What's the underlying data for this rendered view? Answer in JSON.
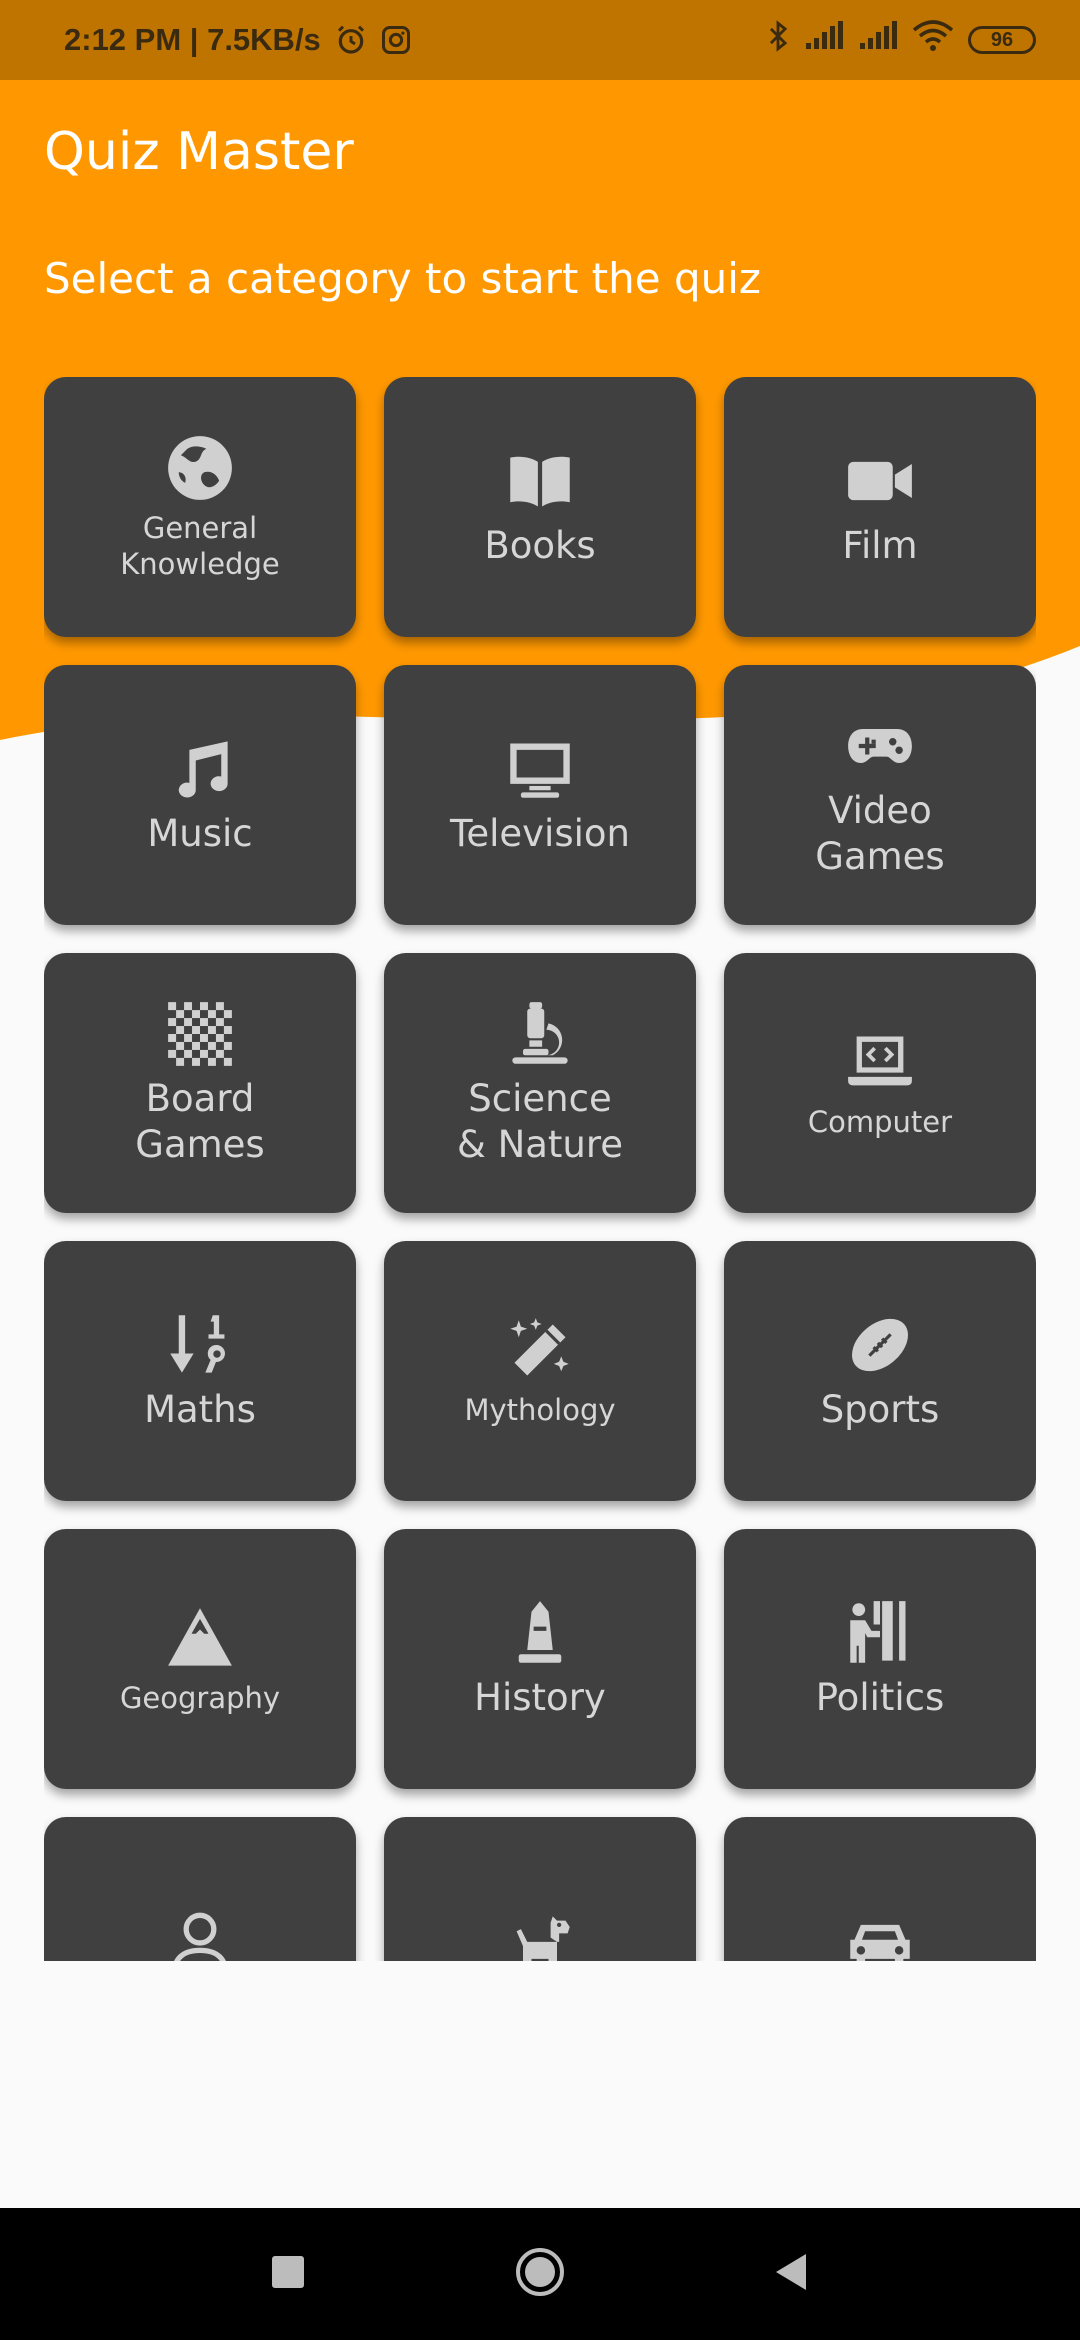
{
  "status_bar": {
    "time": "2:12 PM",
    "speed": "7.5KB/s",
    "battery": "96",
    "icons": [
      "alarm-icon",
      "instagram-icon",
      "bluetooth-icon",
      "signal-icon",
      "signal-icon",
      "wifi-icon",
      "battery-icon"
    ]
  },
  "app": {
    "title": "Quiz Master",
    "subtitle": "Select a category to start the quiz"
  },
  "colors": {
    "header": "#ff9800",
    "status_bar": "#c07400",
    "tile": "#404040",
    "tile_text": "#d6d6d6",
    "background": "#fafafa"
  },
  "categories": [
    {
      "label": "General\nKnowledge",
      "icon": "globe-icon"
    },
    {
      "label": "Books",
      "icon": "book-icon"
    },
    {
      "label": "Film",
      "icon": "video-camera-icon"
    },
    {
      "label": "Music",
      "icon": "music-note-icon"
    },
    {
      "label": "Television",
      "icon": "tv-icon"
    },
    {
      "label": "Video\nGames",
      "icon": "gamepad-icon"
    },
    {
      "label": "Board\nGames",
      "icon": "chessboard-icon"
    },
    {
      "label": "Science\n& Nature",
      "icon": "microscope-icon"
    },
    {
      "label": "Computer",
      "icon": "laptop-code-icon"
    },
    {
      "label": "Maths",
      "icon": "sort-numeric-icon"
    },
    {
      "label": "Mythology",
      "icon": "magic-wand-icon"
    },
    {
      "label": "Sports",
      "icon": "football-icon"
    },
    {
      "label": "Geography",
      "icon": "mountain-icon"
    },
    {
      "label": "History",
      "icon": "monument-icon"
    },
    {
      "label": "Politics",
      "icon": "person-booth-icon"
    },
    {
      "label": "",
      "icon": "user-icon"
    },
    {
      "label": "",
      "icon": "dog-icon"
    },
    {
      "label": "",
      "icon": "car-icon"
    }
  ],
  "nav_bar": {
    "buttons": [
      "recents-square-icon",
      "home-circle-icon",
      "back-triangle-icon"
    ]
  }
}
